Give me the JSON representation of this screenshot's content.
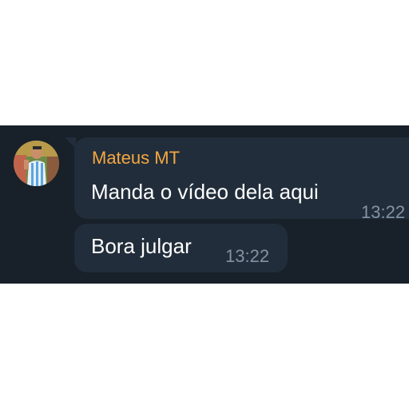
{
  "colors": {
    "chat_background": "#18202a",
    "bubble_background": "#212d3a",
    "sender_name": "#f5a742",
    "message_text": "#ffffff",
    "timestamp": "#8493a4"
  },
  "messages": [
    {
      "sender": "Mateus MT",
      "text": "Manda o vídeo dela aqui",
      "time": "13:22"
    },
    {
      "text": "Bora julgar",
      "time": "13:22"
    }
  ]
}
